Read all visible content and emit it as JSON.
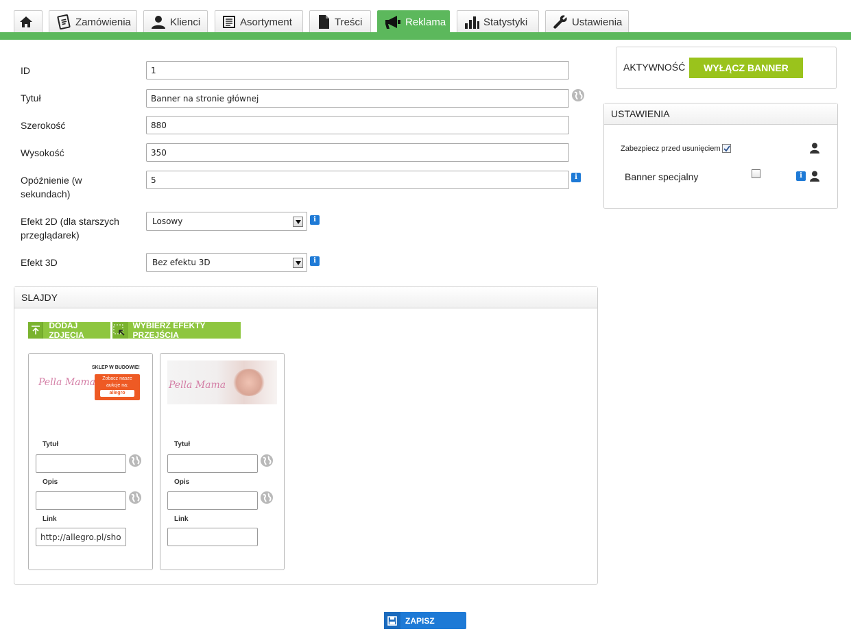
{
  "nav": {
    "tabs": [
      {
        "label": ""
      },
      {
        "label": "Zamówienia"
      },
      {
        "label": "Klienci"
      },
      {
        "label": "Asortyment"
      },
      {
        "label": "Treści"
      },
      {
        "label": "Reklama"
      },
      {
        "label": "Statystyki"
      },
      {
        "label": "Ustawienia"
      }
    ],
    "active": "Reklama",
    "accent": "#5cb85c"
  },
  "form": {
    "id_label": "ID",
    "id_value": "1",
    "title_label": "Tytuł",
    "title_value": "Banner na stronie głównej",
    "width_label": "Szerokość",
    "width_value": "880",
    "height_label": "Wysokość",
    "height_value": "350",
    "delay_label_1": "Opóźnienie (w",
    "delay_label_2": "sekundach)",
    "delay_value": "5",
    "effect2d_label_1": "Efekt 2D (dla starszych",
    "effect2d_label_2": "przeglądarek)",
    "effect2d_value": "Losowy",
    "effect3d_label": "Efekt 3D",
    "effect3d_value": "Bez efektu 3D",
    "info_glyph": "i"
  },
  "activity": {
    "label": "AKTYWNOŚĆ",
    "button": "WYŁĄCZ BANNER",
    "button_color": "#9ac31c"
  },
  "settings": {
    "title": "USTAWIENIA",
    "protect_label": "Zabezpiecz przed usunięciem",
    "protect_checked": true,
    "special_label": "Banner specjalny",
    "special_checked": false
  },
  "slides": {
    "title": "SLAJDY",
    "add_button": "DODAJ ZDJĘCIA",
    "effects_button": "WYBIERZ EFEKTY PRZEJŚCIA",
    "items": [
      {
        "brand": "Pella Mama",
        "banner_header": "SKLEP W BUDOWIE!",
        "banner_line1": "Zobacz nasze",
        "banner_line2": "aukcje na:",
        "banner_logo": "allegro",
        "title_label": "Tytuł",
        "title_value": "",
        "desc_label": "Opis",
        "desc_value": "",
        "link_label": "Link",
        "link_value": "http://allegro.pl/show"
      },
      {
        "brand": "Pella Mama",
        "title_label": "Tytuł",
        "title_value": "",
        "desc_label": "Opis",
        "desc_value": "",
        "link_label": "Link",
        "link_value": ""
      }
    ]
  },
  "save": {
    "label": "ZAPISZ",
    "color": "#1e7ad6"
  }
}
